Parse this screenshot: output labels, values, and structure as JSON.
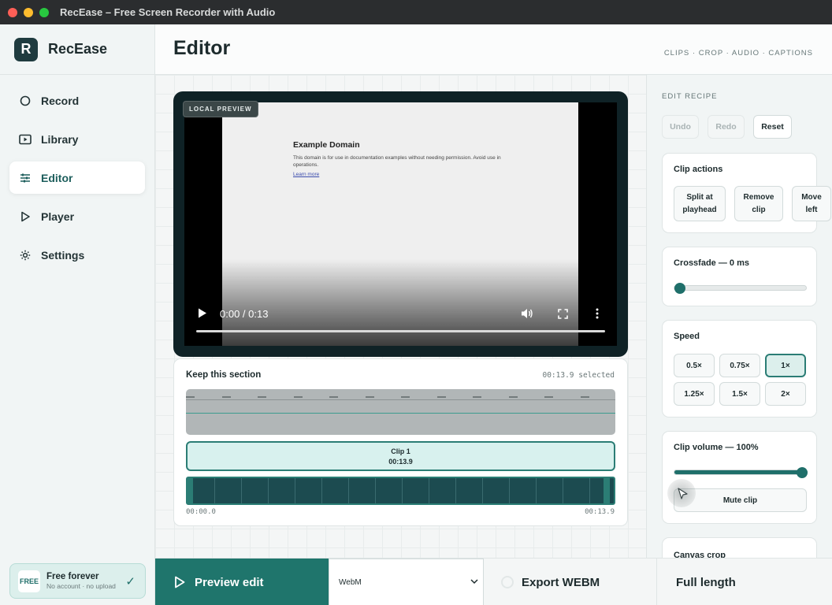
{
  "window": {
    "title": "RecEase – Free Screen Recorder with Audio"
  },
  "sidebar": {
    "brand": "RecEase",
    "logo_letter": "R",
    "items": [
      {
        "label": "Record",
        "icon": "record-icon"
      },
      {
        "label": "Library",
        "icon": "library-icon"
      },
      {
        "label": "Editor",
        "icon": "editor-icon",
        "active": true
      },
      {
        "label": "Player",
        "icon": "play-icon"
      },
      {
        "label": "Settings",
        "icon": "gear-icon"
      }
    ],
    "plan": {
      "badge": "FREE",
      "title": "Free forever",
      "subtitle": "No account · no upload",
      "check": "✓"
    }
  },
  "header": {
    "title": "Editor",
    "tags": "CLIPS · CROP · AUDIO · CAPTIONS"
  },
  "video": {
    "badge": "LOCAL PREVIEW",
    "time": "0:00 / 0:13",
    "progress": 0,
    "page": {
      "title": "Example Domain",
      "body": "This domain is for use in documentation examples without needing permission. Avoid use in operations.",
      "link": "Learn more"
    }
  },
  "section": {
    "title": "Keep this section",
    "selected": "00:13.9 selected",
    "clip_name": "Clip 1",
    "clip_duration": "00:13.9",
    "start_time": "00:00.0",
    "end_time": "00:13.9"
  },
  "panel": {
    "recipe_label": "EDIT RECIPE",
    "undo": "Undo",
    "redo": "Redo",
    "reset": "Reset",
    "clip_actions": {
      "title": "Clip actions",
      "split": [
        "Split at",
        "playhead"
      ],
      "remove": [
        "Remove",
        "clip"
      ],
      "move": [
        "Move",
        "left"
      ]
    },
    "crossfade": {
      "title": "Crossfade — 0 ms",
      "value_ms": 0
    },
    "speed": {
      "title": "Speed",
      "options": [
        "0.5×",
        "0.75×",
        "1×",
        "1.25×",
        "1.5×",
        "2×"
      ],
      "selected": "1×"
    },
    "volume": {
      "title": "Clip volume — 100%",
      "value_pct": 100,
      "mute_label": "Mute clip"
    },
    "crop_title": "Canvas crop"
  },
  "bottom": {
    "preview_label": "Preview edit",
    "format": "WebM",
    "export_label": "Export WEBM",
    "length_label": "Full length"
  },
  "colors": {
    "accent": "#1f756c",
    "accent_light": "#dcefec",
    "dark": "#0f2226"
  }
}
